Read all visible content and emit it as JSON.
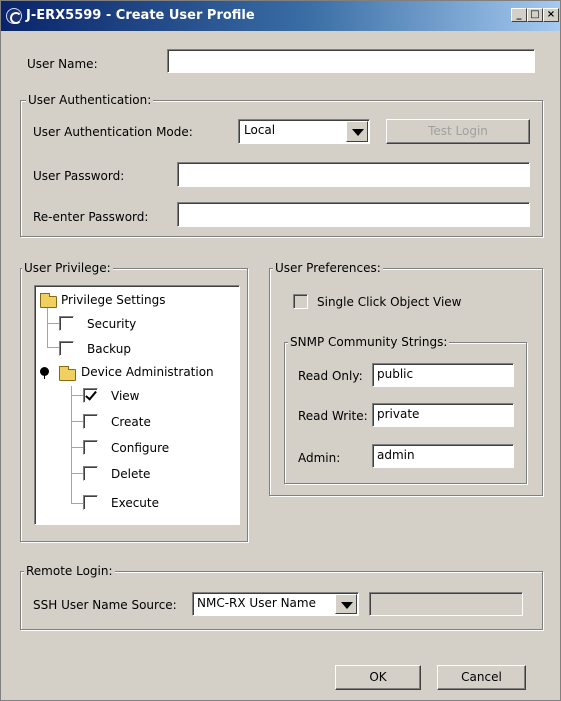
{
  "window": {
    "title": "J-ERX5599 - Create User Profile",
    "minimize_glyph": "_",
    "maximize_glyph": "□",
    "close_glyph": "×"
  },
  "user_name": {
    "label": "User Name:",
    "value": ""
  },
  "authentication": {
    "legend": "User Authentication:",
    "mode_label": "User Authentication Mode:",
    "mode_value": "Local",
    "test_login_label": "Test Login",
    "password_label": "User Password:",
    "password_value": "",
    "reenter_label": "Re-enter Password:",
    "reenter_value": ""
  },
  "privilege": {
    "legend": "User Privilege:",
    "root_label": "Privilege Settings",
    "security_label": "Security",
    "backup_label": "Backup",
    "device_admin_label": "Device Administration",
    "view_label": "View",
    "create_label": "Create",
    "configure_label": "Configure",
    "delete_label": "Delete",
    "execute_label": "Execute"
  },
  "preferences": {
    "legend": "User Preferences:",
    "single_click_label": "Single Click Object View",
    "snmp": {
      "legend": "SNMP Community Strings:",
      "read_only_label": "Read Only:",
      "read_only_value": "public",
      "read_write_label": "Read Write:",
      "read_write_value": "private",
      "admin_label": "Admin:",
      "admin_value": "admin"
    }
  },
  "remote_login": {
    "legend": "Remote Login:",
    "ssh_label": "SSH User Name Source:",
    "ssh_value": "NMC-RX User Name",
    "ssh_extra_value": ""
  },
  "buttons": {
    "ok_label": "OK",
    "cancel_label": "Cancel"
  }
}
